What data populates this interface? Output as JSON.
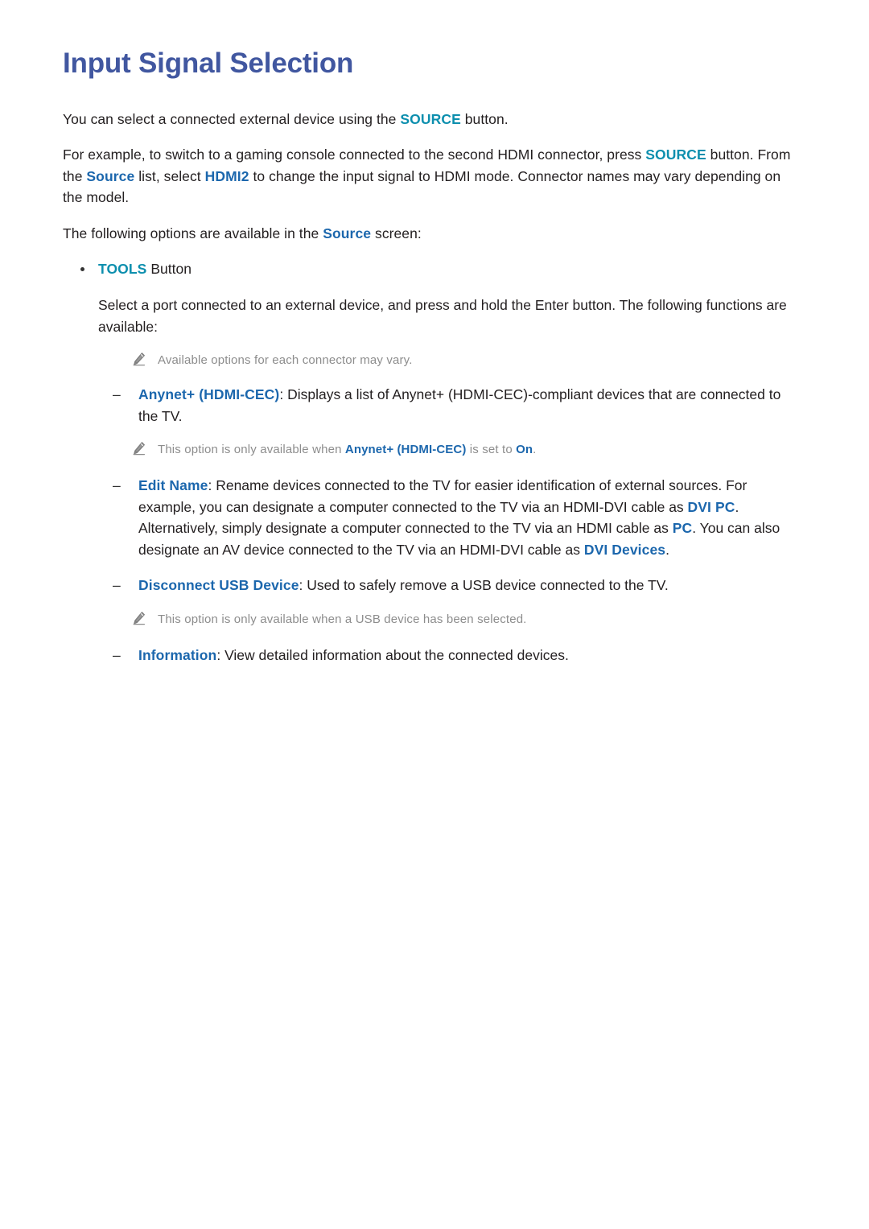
{
  "page": {
    "title": "Input Signal Selection",
    "title_color": "#4157a0",
    "keyword_teal_color": "#0d8fae",
    "keyword_blue_color": "#1c67ad",
    "note_text_color": "#8d8d8d",
    "body_text_color": "#231f20",
    "background_color": "#ffffff"
  },
  "intro": {
    "p1_a": "You can select a connected external device using the ",
    "p1_kw_source": "SOURCE",
    "p1_b": " button.",
    "p2_a": "For example, to switch to a gaming console connected to the second HDMI connector, press ",
    "p2_kw_source": "SOURCE",
    "p2_b": " button. From the ",
    "p2_kw_source_list": "Source",
    "p2_c": " list, select ",
    "p2_kw_hdmi2": "HDMI2",
    "p2_d": " to change the input signal to HDMI mode. Connector names may vary depending on the model.",
    "p3_a": "The following options are available in the ",
    "p3_kw_source": "Source",
    "p3_b": " screen:"
  },
  "tools": {
    "bullet_kw": "TOOLS",
    "bullet_text": " Button",
    "description": "Select a port connected to an external device, and press and hold the Enter button. The following functions are available:",
    "note": "Available options for each connector may vary."
  },
  "items": [
    {
      "dash": "–",
      "kw": "Anynet+ (HDMI-CEC)",
      "text": ": Displays a list of Anynet+ (HDMI-CEC)-compliant devices that are connected to the TV.",
      "note_a": "This option is only available when ",
      "note_kw1": "Anynet+ (HDMI-CEC)",
      "note_b": " is set to ",
      "note_kw2": "On",
      "note_c": "."
    },
    {
      "dash": "–",
      "kw": "Edit Name",
      "text_a": ": Rename devices connected to the TV for easier identification of external sources. For example, you can designate a computer connected to the TV via an HDMI-DVI cable as ",
      "kw2": "DVI PC",
      "text_b": ". Alternatively, simply designate a computer connected to the TV via an HDMI cable as ",
      "kw3": "PC",
      "text_c": ". You can also designate an AV device connected to the TV via an HDMI-DVI cable as ",
      "kw4": "DVI Devices",
      "text_d": "."
    },
    {
      "dash": "–",
      "kw": "Disconnect USB Device",
      "text": ": Used to safely remove a USB device connected to the TV.",
      "note": "This option is only available when a USB device has been selected."
    },
    {
      "dash": "–",
      "kw": "Information",
      "text": ": View detailed information about the connected devices."
    }
  ]
}
